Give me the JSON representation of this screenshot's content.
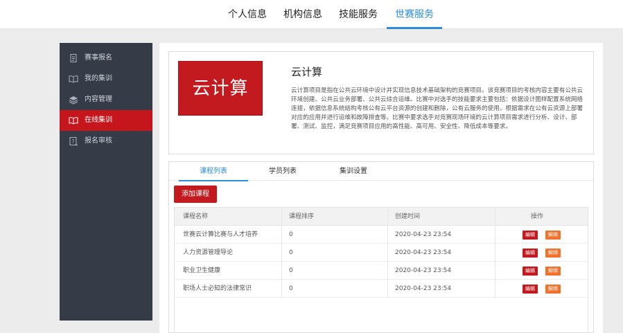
{
  "topnav": {
    "tabs": [
      {
        "label": "个人信息"
      },
      {
        "label": "机构信息"
      },
      {
        "label": "技能服务"
      },
      {
        "label": "世赛服务"
      }
    ],
    "active_tab": "世赛服务"
  },
  "sidebar": {
    "items": [
      {
        "label": "赛事报名",
        "icon": "document-icon"
      },
      {
        "label": "我的集训",
        "icon": "book-icon"
      },
      {
        "label": "内容管理",
        "icon": "layers-icon"
      },
      {
        "label": "在线集训",
        "icon": "book-icon"
      },
      {
        "label": "报名审核",
        "icon": "review-icon"
      }
    ],
    "active_item": "在线集训"
  },
  "intro": {
    "logo_text": "云计算",
    "title": "云计算",
    "description": "云计算项目是指在公共云环境中设计并实现信息技术基础架构的竞赛项目。该竞赛项目的考核内容主要有公共云环境创建、公共云业务部署、公共云综合运维。比赛中对选手的技能要求主要包括：依据设计图样配置系统网络连接，依据信息系统结构考核公有云平台资源的创建和删除，公有云服务的使用，根据需求在公有云资源上部署对应的应用并进行运维和故障排查等。比赛中要求选手对竞赛现场环境的云计算项目需求进行分析、设计、部署、测试、监控，满足竞赛项目应用的高性能、高可用、安全性、降低成本等要求。"
  },
  "subtabs": [
    {
      "label": "课程列表"
    },
    {
      "label": "学员列表"
    },
    {
      "label": "集训设置"
    }
  ],
  "active_subtab": "课程列表",
  "add_button": "添加课程",
  "table": {
    "headers": [
      "课程名称",
      "课程排序",
      "创建时间",
      "操作"
    ],
    "rows": [
      {
        "name": "世赛云计算比赛与人才培养",
        "order": "0",
        "created": "2020-04-23 23:54",
        "edit": "编辑",
        "unbind": "解绑"
      },
      {
        "name": "人力资源管理导论",
        "order": "0",
        "created": "2020-04-23 23:54",
        "edit": "编辑",
        "unbind": "解绑"
      },
      {
        "name": "职业卫生健康",
        "order": "0",
        "created": "2020-04-23 23:54",
        "edit": "编辑",
        "unbind": "解绑"
      },
      {
        "name": "职场人士必知的法律常识",
        "order": "0",
        "created": "2020-04-23 23:54",
        "edit": "编辑",
        "unbind": "解绑"
      }
    ]
  },
  "colors": {
    "accent_blue": "#2d8cd9",
    "brand_red": "#c31a20",
    "unbind_orange": "#f0722c",
    "sidebar_bg": "#353b47"
  }
}
